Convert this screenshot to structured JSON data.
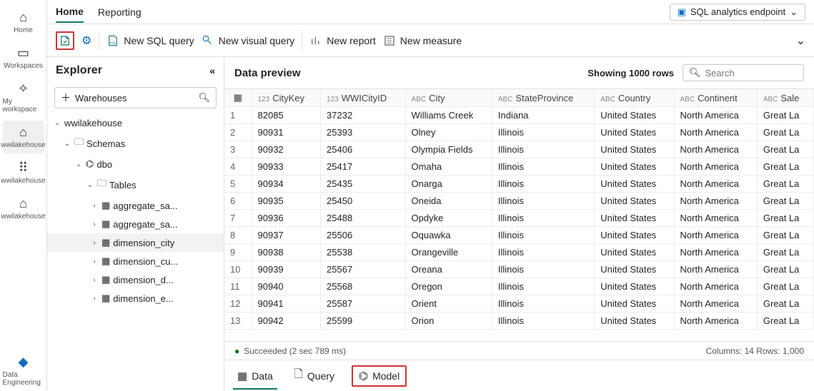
{
  "rail": {
    "items": [
      {
        "label": "Home",
        "icon": "⌂",
        "name": "rail-home"
      },
      {
        "label": "Workspaces",
        "icon": "▭",
        "name": "rail-workspaces"
      },
      {
        "label": "My workspace",
        "icon": "✧",
        "name": "rail-my-workspace"
      },
      {
        "label": "wwilakehouse",
        "icon": "⌂",
        "name": "rail-wwilakehouse-1",
        "active": true
      },
      {
        "label": "wwilakehouse",
        "icon": "⠿",
        "name": "rail-wwilakehouse-2"
      },
      {
        "label": "wwilakehouse",
        "icon": "⌂",
        "name": "rail-wwilakehouse-3"
      }
    ],
    "bottom": {
      "label": "Data Engineering",
      "name": "rail-data-engineering"
    }
  },
  "ribbon": {
    "tabs": [
      {
        "label": "Home",
        "active": true
      },
      {
        "label": "Reporting"
      }
    ],
    "endpoint_label": "SQL analytics endpoint"
  },
  "toolbar": {
    "new_sql_query": "New SQL query",
    "new_visual_query": "New visual query",
    "new_report": "New report",
    "new_measure": "New measure"
  },
  "explorer": {
    "title": "Explorer",
    "filter_label": "Warehouses",
    "tree": {
      "root": "wwilakehouse",
      "schemas_label": "Schemas",
      "schema": "dbo",
      "tables_label": "Tables",
      "tables": [
        {
          "label": "aggregate_sa...",
          "sel": false
        },
        {
          "label": "aggregate_sa...",
          "sel": false
        },
        {
          "label": "dimension_city",
          "sel": true
        },
        {
          "label": "dimension_cu...",
          "sel": false
        },
        {
          "label": "dimension_d...",
          "sel": false
        },
        {
          "label": "dimension_e...",
          "sel": false
        }
      ]
    }
  },
  "preview": {
    "title": "Data preview",
    "showing": "Showing 1000 rows",
    "search_placeholder": "Search",
    "columns": [
      {
        "type": "123",
        "label": "CityKey"
      },
      {
        "type": "123",
        "label": "WWICityID"
      },
      {
        "type": "ABC",
        "label": "City"
      },
      {
        "type": "ABC",
        "label": "StateProvince"
      },
      {
        "type": "ABC",
        "label": "Country"
      },
      {
        "type": "ABC",
        "label": "Continent"
      },
      {
        "type": "ABC",
        "label": "Sale"
      }
    ],
    "rows": [
      [
        "82085",
        "37232",
        "Williams Creek",
        "Indiana",
        "United States",
        "North America",
        "Great La"
      ],
      [
        "90931",
        "25393",
        "Olney",
        "Illinois",
        "United States",
        "North America",
        "Great La"
      ],
      [
        "90932",
        "25406",
        "Olympia Fields",
        "Illinois",
        "United States",
        "North America",
        "Great La"
      ],
      [
        "90933",
        "25417",
        "Omaha",
        "Illinois",
        "United States",
        "North America",
        "Great La"
      ],
      [
        "90934",
        "25435",
        "Onarga",
        "Illinois",
        "United States",
        "North America",
        "Great La"
      ],
      [
        "90935",
        "25450",
        "Oneida",
        "Illinois",
        "United States",
        "North America",
        "Great La"
      ],
      [
        "90936",
        "25488",
        "Opdyke",
        "Illinois",
        "United States",
        "North America",
        "Great La"
      ],
      [
        "90937",
        "25506",
        "Oquawka",
        "Illinois",
        "United States",
        "North America",
        "Great La"
      ],
      [
        "90938",
        "25538",
        "Orangeville",
        "Illinois",
        "United States",
        "North America",
        "Great La"
      ],
      [
        "90939",
        "25567",
        "Oreana",
        "Illinois",
        "United States",
        "North America",
        "Great La"
      ],
      [
        "90940",
        "25568",
        "Oregon",
        "Illinois",
        "United States",
        "North America",
        "Great La"
      ],
      [
        "90941",
        "25587",
        "Orient",
        "Illinois",
        "United States",
        "North America",
        "Great La"
      ],
      [
        "90942",
        "25599",
        "Orion",
        "Illinois",
        "United States",
        "North America",
        "Great La"
      ]
    ],
    "status": "Succeeded (2 sec 789 ms)",
    "counts": "Columns: 14  Rows: 1,000"
  },
  "bottom_tabs": {
    "data": "Data",
    "query": "Query",
    "model": "Model"
  }
}
